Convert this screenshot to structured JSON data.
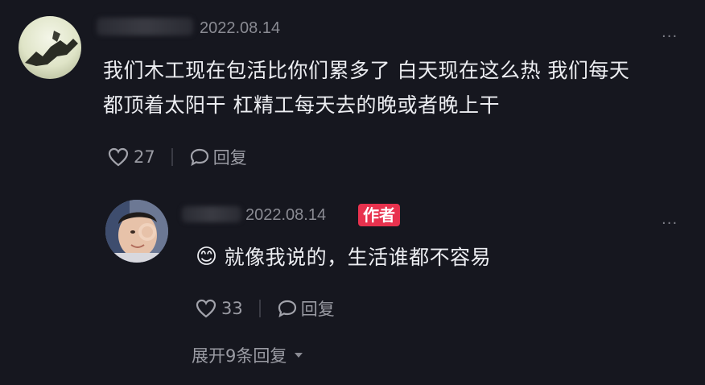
{
  "comment": {
    "date": "2022.08.14",
    "text_line1": "我们木工现在包活比你们累多了 白天现在这么热 我们每天",
    "text_line2": "都顶着太阳干 杠精工每天去的晚或者晚上干",
    "like_count": "27",
    "reply_label": "回复",
    "more": "..."
  },
  "reply": {
    "date": "2022.08.14",
    "author_badge": "作者",
    "emoji": "😊",
    "text": "就像我说的，生活谁都不容易",
    "like_count": "33",
    "reply_label": "回复",
    "more": "..."
  },
  "expand": {
    "label": "展开9条回复"
  }
}
